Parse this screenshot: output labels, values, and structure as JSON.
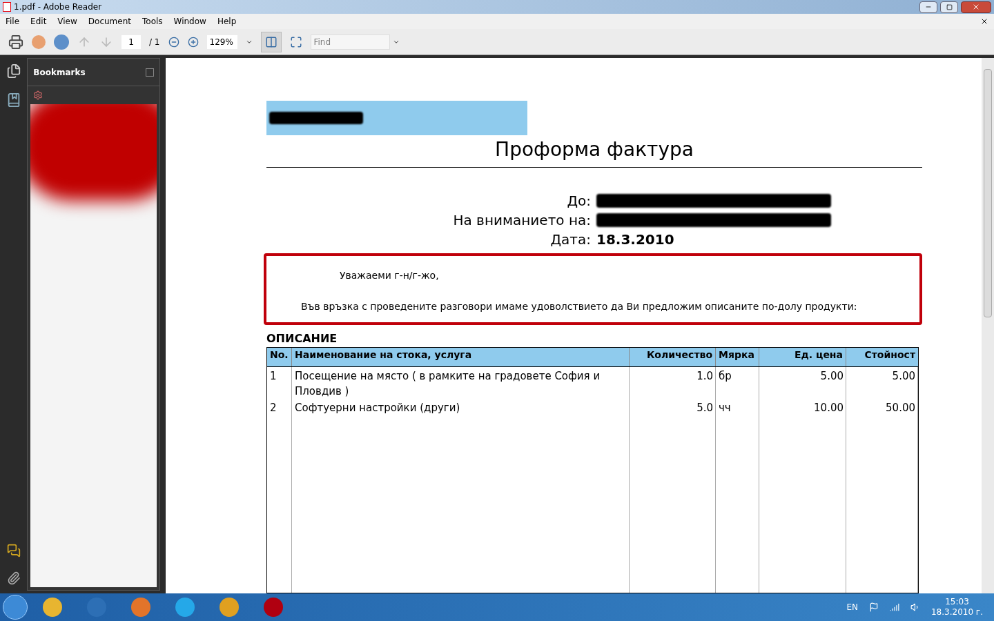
{
  "window": {
    "title": "1.pdf - Adobe Reader"
  },
  "menu": [
    "File",
    "Edit",
    "View",
    "Document",
    "Tools",
    "Window",
    "Help"
  ],
  "toolbar": {
    "page": "1",
    "page_total": "/ 1",
    "zoom": "129%",
    "find_placeholder": "Find"
  },
  "bookmarks": {
    "title": "Bookmarks"
  },
  "document": {
    "title": "Проформа фактура",
    "address": [
      {
        "label": "До:",
        "kind": "redacted"
      },
      {
        "label": "На вниманието на:",
        "kind": "redacted"
      },
      {
        "label": "Дата:",
        "kind": "text",
        "value": "18.3.2010"
      }
    ],
    "greeting": "Уважаеми г-н/г-жо,",
    "intro": "Във връзка с проведените разговори имаме удоволствието да Ви предложим описаните по-долу продукти:",
    "section": "ОПИСАНИЕ",
    "columns": [
      "No.",
      "Наименование на стока, услуга",
      "Количество",
      "Мярка",
      "Ед. цена",
      "Стойност"
    ],
    "rows": [
      [
        "1",
        "Посещение на място ( в рамките на градовете София и Пловдив )",
        "1.0",
        "бр",
        "5.00",
        "5.00"
      ],
      [
        "2",
        "Софтуерни настройки  (други)",
        "5.0",
        "чч",
        "10.00",
        "50.00"
      ]
    ]
  },
  "tray": {
    "language": "EN",
    "time": "15:03",
    "date": "18.3.2010 г."
  }
}
